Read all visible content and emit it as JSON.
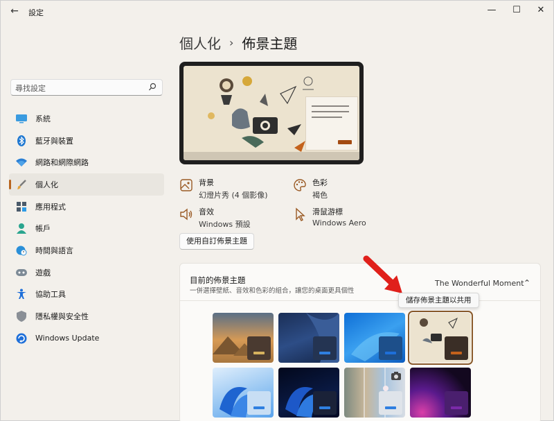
{
  "window": {
    "title": "設定",
    "back_glyph": "←",
    "minimize_glyph": "—",
    "maximize_glyph": "☐",
    "close_glyph": "✕"
  },
  "search": {
    "placeholder": "尋找設定"
  },
  "sidebar": {
    "items": [
      {
        "label": "系統",
        "icon": "monitor-icon"
      },
      {
        "label": "藍牙與裝置",
        "icon": "bluetooth-icon"
      },
      {
        "label": "網路和網際網路",
        "icon": "wifi-icon"
      },
      {
        "label": "個人化",
        "icon": "brush-icon",
        "active": true
      },
      {
        "label": "應用程式",
        "icon": "apps-icon"
      },
      {
        "label": "帳戶",
        "icon": "person-icon"
      },
      {
        "label": "時間與語言",
        "icon": "globe-clock-icon"
      },
      {
        "label": "遊戲",
        "icon": "gamepad-icon"
      },
      {
        "label": "協助工具",
        "icon": "accessibility-icon"
      },
      {
        "label": "隱私權與安全性",
        "icon": "shield-icon"
      },
      {
        "label": "Windows Update",
        "icon": "update-icon"
      }
    ]
  },
  "breadcrumb": {
    "parent": "個人化",
    "separator": "›",
    "current": "佈景主題"
  },
  "properties": {
    "background": {
      "title": "背景",
      "value": "幻燈片秀 (4 個影像)",
      "icon": "image-icon"
    },
    "color": {
      "title": "色彩",
      "value": "褐色",
      "icon": "palette-icon"
    },
    "sound": {
      "title": "音效",
      "value": "Windows 預設",
      "icon": "speaker-icon"
    },
    "cursor": {
      "title": "滑鼠游標",
      "value": "Windows Aero",
      "icon": "cursor-icon"
    }
  },
  "custom_theme_button": "使用自訂佈景主題",
  "current_theme": {
    "title": "目前的佈景主題",
    "description": "一併選擇壁紙、音效和色彩的組合，讓您的桌面更具個性",
    "value": "The Wonderful Moment",
    "chevron": "⌃"
  },
  "tooltip": "儲存佈景主題以共用",
  "colors": {
    "accent": "#b8651f",
    "arrow": "#e0201b"
  },
  "themes": [
    {
      "name": "theme-desert",
      "accent": "#d6b25e"
    },
    {
      "name": "theme-windows-dark-blue",
      "accent": "#2f7fe0"
    },
    {
      "name": "theme-windows-light",
      "accent": "#1e6fd9"
    },
    {
      "name": "theme-wonderful-moment",
      "accent": "#c4621c",
      "selected": true
    },
    {
      "name": "theme-bloom-light",
      "accent": "#2f7fe0"
    },
    {
      "name": "theme-bloom-dark",
      "accent": "#2f7fe0"
    },
    {
      "name": "theme-spotlight",
      "accent": "#2f7fe0"
    },
    {
      "name": "theme-glow",
      "accent": "#7a2aa8"
    }
  ]
}
